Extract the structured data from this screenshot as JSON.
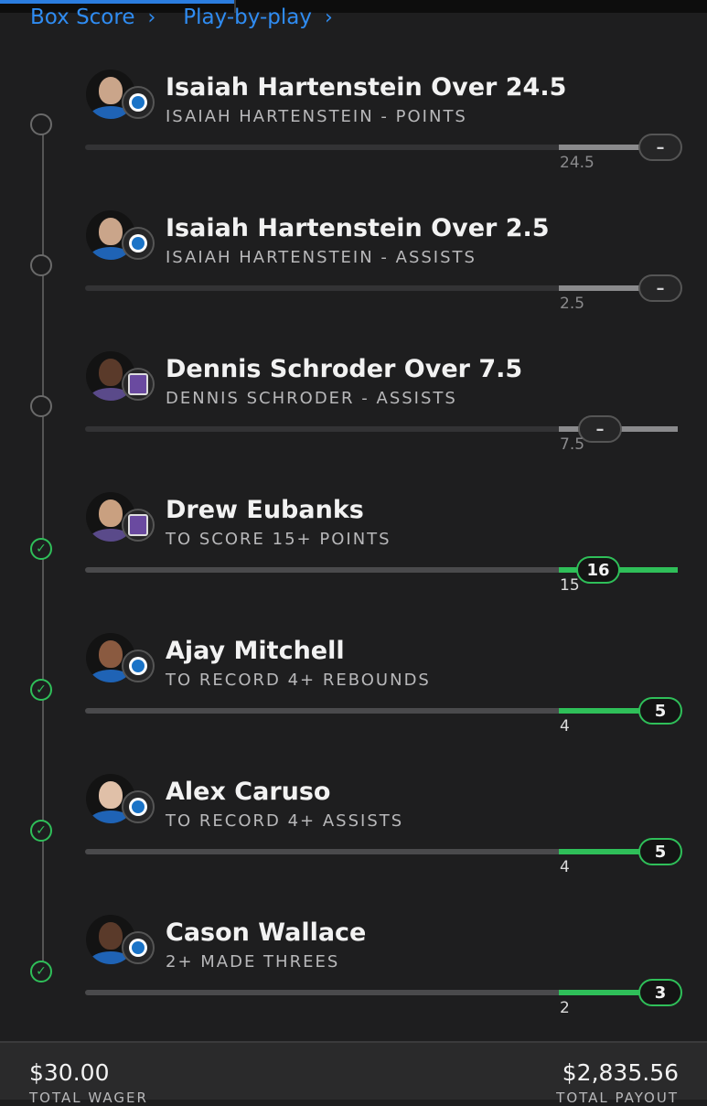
{
  "nav": {
    "box_score": "Box Score",
    "play_by_play": "Play-by-play"
  },
  "legs": [
    {
      "title": "Isaiah Hartenstein Over 24.5",
      "subtitle": "ISAIAH HARTENSTEIN - POINTS",
      "target": "24.5",
      "current": "–",
      "status": "pending",
      "team_logo": "okc-thunder-logo"
    },
    {
      "title": "Isaiah Hartenstein Over 2.5",
      "subtitle": "ISAIAH HARTENSTEIN - ASSISTS",
      "target": "2.5",
      "current": "–",
      "status": "pending",
      "team_logo": "okc-thunder-logo"
    },
    {
      "title": "Dennis Schroder Over 7.5",
      "subtitle": "DENNIS SCHRODER - ASSISTS",
      "target": "7.5",
      "current": "–",
      "status": "pending",
      "team_logo": "sacramento-kings-logo"
    },
    {
      "title": "Drew Eubanks",
      "subtitle": "TO SCORE 15+ POINTS",
      "target": "15",
      "current": "16",
      "status": "won",
      "team_logo": "sacramento-kings-logo"
    },
    {
      "title": "Ajay Mitchell",
      "subtitle": "TO RECORD 4+ REBOUNDS",
      "target": "4",
      "current": "5",
      "status": "won",
      "team_logo": "okc-thunder-logo"
    },
    {
      "title": "Alex Caruso",
      "subtitle": "TO RECORD 4+ ASSISTS",
      "target": "4",
      "current": "5",
      "status": "won",
      "team_logo": "okc-thunder-logo"
    },
    {
      "title": "Cason Wallace",
      "subtitle": "2+ MADE THREES",
      "target": "2",
      "current": "3",
      "status": "won",
      "team_logo": "okc-thunder-logo"
    }
  ],
  "footer": {
    "wager": "$30.00",
    "wager_label": "TOTAL WAGER",
    "payout": "$2,835.56",
    "payout_label": "TOTAL PAYOUT"
  },
  "colors": {
    "accent_blue": "#2f8cf2",
    "success_green": "#2fbf59",
    "background": "#1e1e1f"
  }
}
